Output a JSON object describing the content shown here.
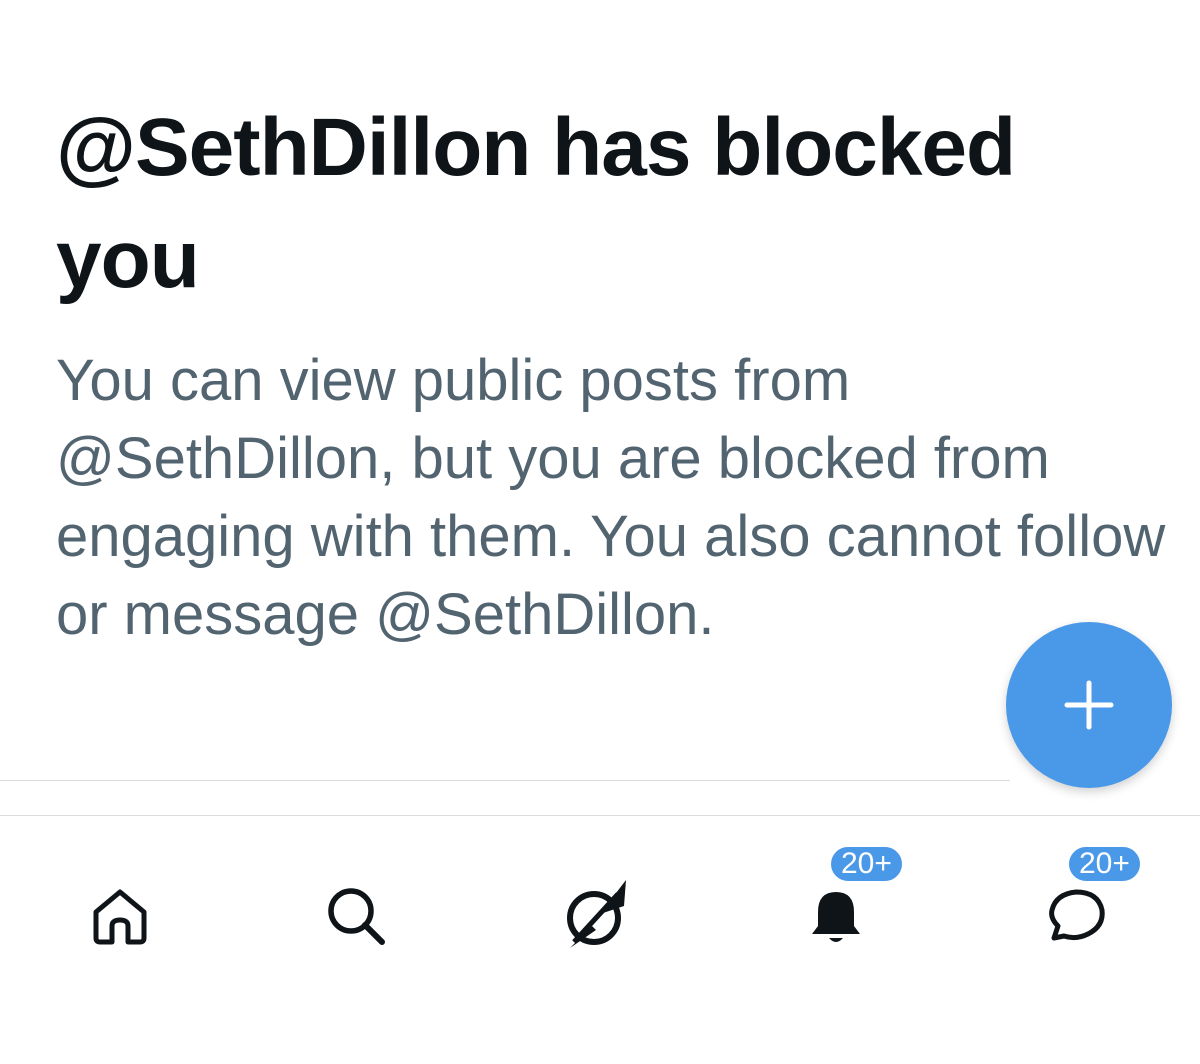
{
  "block_notice": {
    "title": "@SethDillon has blocked you",
    "body": "You can view public posts from @SethDillon, but you are blocked from engaging with them. You also cannot follow or message @SethDillon."
  },
  "compose_button": {
    "icon": "plus-icon",
    "color": "#4a99e9"
  },
  "tab_bar": {
    "items": [
      {
        "name": "home",
        "icon": "home-icon"
      },
      {
        "name": "search",
        "icon": "search-icon"
      },
      {
        "name": "grok",
        "icon": "grok-icon"
      },
      {
        "name": "notifications",
        "icon": "bell-icon",
        "badge": "20+"
      },
      {
        "name": "messages",
        "icon": "message-icon",
        "badge": "20+"
      }
    ]
  },
  "colors": {
    "title": "#0f1419",
    "body": "#536471",
    "accent": "#4a99e9",
    "divider": "#d9dde0"
  }
}
